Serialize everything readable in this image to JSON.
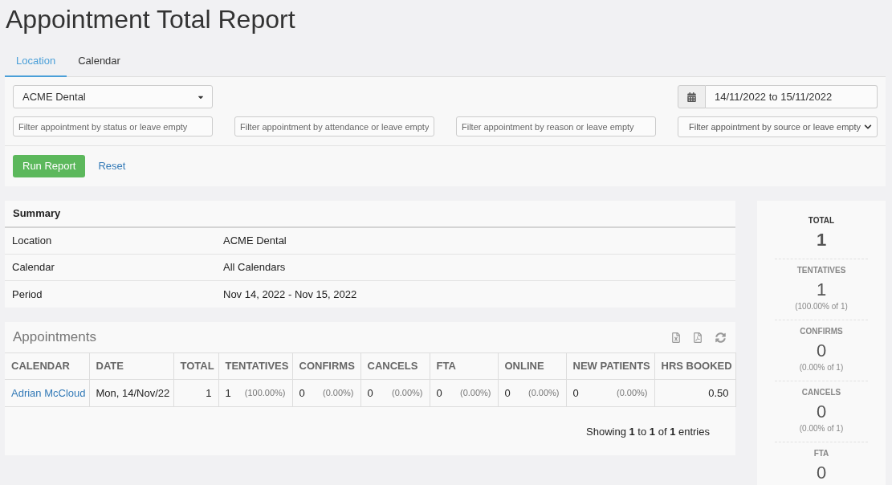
{
  "page": {
    "title": "Appointment Total Report"
  },
  "tabs": [
    {
      "label": "Location",
      "selected": true
    },
    {
      "label": "Calendar",
      "selected": false
    }
  ],
  "filters": {
    "location_select": {
      "value": "ACME Dental"
    },
    "date_range": {
      "value": "14/11/2022 to 15/11/2022"
    },
    "fields": [
      {
        "kind": "input",
        "placeholder": "Filter appointment by status or leave empty"
      },
      {
        "kind": "input",
        "placeholder": "Filter appointment by attendance or leave empty"
      },
      {
        "kind": "input",
        "placeholder": "Filter appointment by reason or leave empty"
      },
      {
        "kind": "select",
        "placeholder": "Filter appointment by source or leave empty"
      }
    ]
  },
  "buttons": [
    {
      "label": "Run Report",
      "kind": "primary"
    },
    {
      "label": "Reset",
      "kind": "link"
    }
  ],
  "summary": {
    "title": "Summary",
    "rows": [
      {
        "label": "Location",
        "value": "ACME Dental"
      },
      {
        "label": "Calendar",
        "value": "All Calendars"
      },
      {
        "label": "Period",
        "value": "Nov 14, 2022 - Nov 15, 2022"
      }
    ]
  },
  "appointments": {
    "title": "Appointments",
    "columns": [
      "CALENDAR",
      "DATE",
      "TOTAL",
      "TENTATIVES",
      "CONFIRMS",
      "CANCELS",
      "FTA",
      "ONLINE",
      "NEW PATIENTS",
      "HRS BOOKED"
    ],
    "rows": [
      {
        "cells": [
          {
            "kind": "link",
            "text": "Adrian McCloud"
          },
          {
            "kind": "text",
            "text": "Mon, 14/Nov/22"
          },
          {
            "kind": "number",
            "text": "1"
          },
          {
            "kind": "count",
            "count": "1",
            "percent": "(100.00%)"
          },
          {
            "kind": "count",
            "count": "0",
            "percent": "(0.00%)"
          },
          {
            "kind": "count",
            "count": "0",
            "percent": "(0.00%)"
          },
          {
            "kind": "count",
            "count": "0",
            "percent": "(0.00%)"
          },
          {
            "kind": "count",
            "count": "0",
            "percent": "(0.00%)"
          },
          {
            "kind": "count",
            "count": "0",
            "percent": "(0.00%)"
          },
          {
            "kind": "number",
            "text": "0.50"
          }
        ]
      }
    ],
    "footer": "Showing **1** to **1** of **1** entries"
  },
  "stats": [
    {
      "kind": "total",
      "label": "TOTAL",
      "value": "1"
    },
    {
      "kind": "share",
      "label": "TENTATIVES",
      "value": "1",
      "sub": "(100.00% of 1)"
    },
    {
      "kind": "share",
      "label": "CONFIRMS",
      "value": "0",
      "sub": "(0.00% of 1)"
    },
    {
      "kind": "share",
      "label": "CANCELS",
      "value": "0",
      "sub": "(0.00% of 1)"
    },
    {
      "kind": "share",
      "label": "FTA",
      "value": "0"
    }
  ]
}
